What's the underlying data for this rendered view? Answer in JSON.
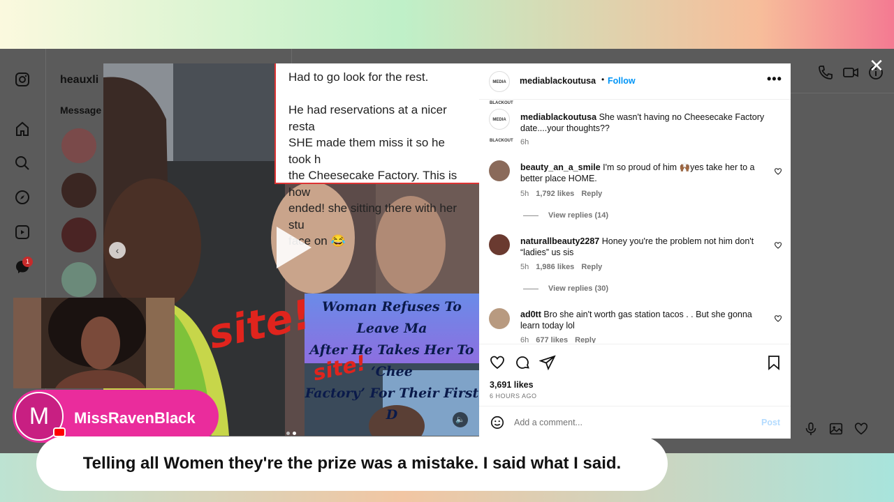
{
  "post": {
    "username": "mediablackoutusa",
    "avatar_text": "MEDIA BLACKOUT",
    "follow_label": "Follow",
    "more_label": "•••",
    "caption_text": "She wasn't having no Cheesecake Factory date....your thoughts??",
    "caption_age": "6h",
    "likes": "3,691 likes",
    "posted_ago": "6 HOURS AGO",
    "add_comment_placeholder": "Add a comment...",
    "post_label": "Post"
  },
  "comments": [
    {
      "username": "beauty_an_a_smile",
      "text": "I'm so proud of him 🙌🏾yes take her to a better place HOME.",
      "age": "5h",
      "likes": "1,792 likes",
      "reply": "Reply",
      "view_replies": "View replies (14)"
    },
    {
      "username": "naturallbeauty2287",
      "text": "Honey you're the problem not him don't “ladies” us sis",
      "age": "5h",
      "likes": "1,986 likes",
      "reply": "Reply",
      "view_replies": "View replies (30)"
    },
    {
      "username": "ad0tt",
      "text": "Bro she ain't worth gas station tacos . . But she gonna learn today lol",
      "age": "6h",
      "likes": "677 likes",
      "reply": "Reply"
    }
  ],
  "media": {
    "caption_card": "Had to go look for the rest.\n\nHe had reservations at a nicer resta\nSHE made them miss it so he took h\nthe Cheesecake Factory. This is how\nended! she sitting there with her stu\nface on 😂",
    "headline": "Woman Refuses To Leave Ma\nAfter He Takes Her To ‘Chee\nFactory’ For Their First D",
    "watermark": "site!",
    "watermark_small": "site!"
  },
  "instagram": {
    "inbox_username": "heauxli",
    "messages_tab": "Message",
    "notification_count": "1"
  },
  "stream": {
    "streamer_initial": "M",
    "streamer_name": "MissRavenBlack",
    "subtitle": "Telling all Women they're the prize was a mistake. I said what I said."
  },
  "colors": {
    "accent_link": "#0095f6",
    "badge_pink": "#ea2c9c",
    "watermark_red": "#e0241d"
  }
}
